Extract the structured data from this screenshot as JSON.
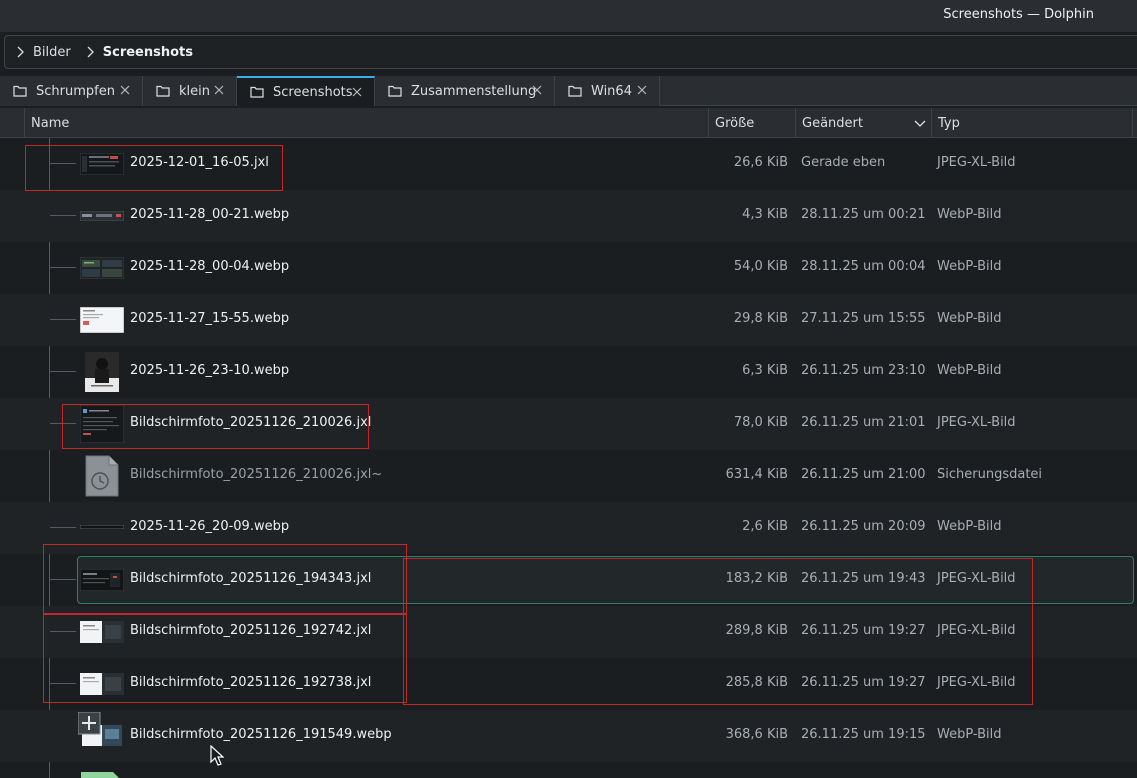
{
  "window": {
    "title": "Screenshots — Dolphin"
  },
  "breadcrumb": {
    "items": [
      "Bilder",
      "Screenshots"
    ]
  },
  "tabs": [
    {
      "label": "Schrumpfen",
      "active": false
    },
    {
      "label": "klein",
      "active": false
    },
    {
      "label": "Screenshots",
      "active": true
    },
    {
      "label": "Zusammenstellung",
      "active": false
    },
    {
      "label": "Win64",
      "active": false
    }
  ],
  "columns": {
    "name": "Name",
    "size": "Größe",
    "modified": "Geändert",
    "type": "Typ"
  },
  "files": [
    {
      "name": "2025-12-01_16-05.jxl",
      "size": "26,6 KiB",
      "modified": "Gerade eben",
      "type": "JPEG-XL-Bild",
      "thumb": "dark-ui-thumb"
    },
    {
      "name": "2025-11-28_00-21.webp",
      "size": "4,3 KiB",
      "modified": "28.11.25 um 00:21",
      "type": "WebP-Bild",
      "thumb": "thin-bar-thumb"
    },
    {
      "name": "2025-11-28_00-04.webp",
      "size": "54,0 KiB",
      "modified": "28.11.25 um 00:04",
      "type": "WebP-Bild",
      "thumb": "dark-grid-thumb"
    },
    {
      "name": "2025-11-27_15-55.webp",
      "size": "29,8 KiB",
      "modified": "27.11.25 um 15:55",
      "type": "WebP-Bild",
      "thumb": "light-page-thumb"
    },
    {
      "name": "2025-11-26_23-10.webp",
      "size": "6,3 KiB",
      "modified": "26.11.25 um 23:10",
      "type": "WebP-Bild",
      "thumb": "photo-portrait-thumb"
    },
    {
      "name": "Bildschirmfoto_20251126_210026.jxl",
      "size": "78,0 KiB",
      "modified": "26.11.25 um 21:01",
      "type": "JPEG-XL-Bild",
      "thumb": "dark-doc-thumb"
    },
    {
      "name": "Bildschirmfoto_20251126_210026.jxl~",
      "size": "631,4 KiB",
      "modified": "26.11.25 um 21:00",
      "type": "Sicherungsdatei",
      "thumb": "backup-file-icon"
    },
    {
      "name": "2025-11-26_20-09.webp",
      "size": "2,6 KiB",
      "modified": "26.11.25 um 20:09",
      "type": "WebP-Bild",
      "thumb": "thin-line-thumb"
    },
    {
      "name": "Bildschirmfoto_20251126_194343.jxl",
      "size": "183,2 KiB",
      "modified": "26.11.25 um 19:43",
      "type": "JPEG-XL-Bild",
      "thumb": "dark-wide-thumb"
    },
    {
      "name": "Bildschirmfoto_20251126_192742.jxl",
      "size": "289,8 KiB",
      "modified": "26.11.25 um 19:27",
      "type": "JPEG-XL-Bild",
      "thumb": "split-thumb"
    },
    {
      "name": "Bildschirmfoto_20251126_192738.jxl",
      "size": "285,8 KiB",
      "modified": "26.11.25 um 19:27",
      "type": "JPEG-XL-Bild",
      "thumb": "split-thumb"
    },
    {
      "name": "Bildschirmfoto_20251126_191549.webp",
      "size": "368,6 KiB",
      "modified": "26.11.25 um 19:15",
      "type": "WebP-Bild",
      "thumb": "split-overlay-thumb"
    }
  ],
  "colors": {
    "accent": "#3daee9",
    "annotation": "#c0282a",
    "hover_frame": "#2e7f72"
  }
}
